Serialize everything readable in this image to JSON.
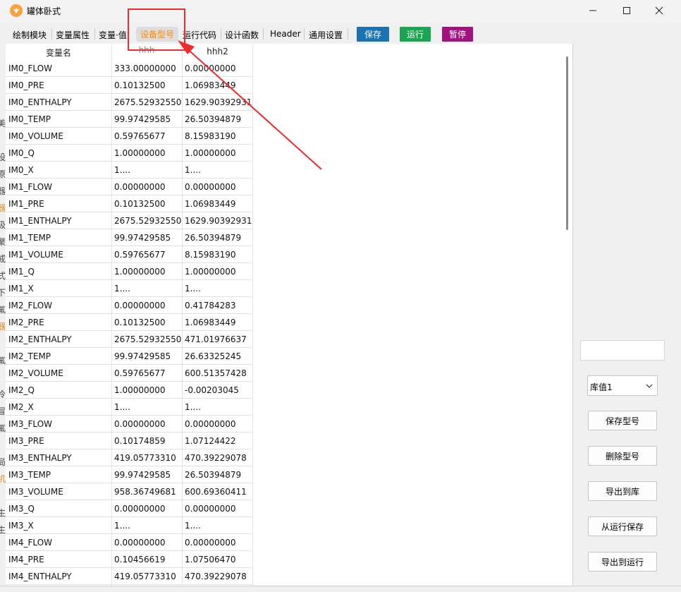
{
  "window": {
    "title": "罐体卧式",
    "controls": [
      "minimize",
      "maximize",
      "close"
    ]
  },
  "menu": {
    "tabs": [
      {
        "label": "绘制模块",
        "active": false
      },
      {
        "label": "变量属性",
        "active": false
      },
      {
        "label": "变量·值",
        "active": false
      },
      {
        "label": "设备型号",
        "active": true
      },
      {
        "label": "运行代码",
        "active": false
      },
      {
        "label": "设计函数",
        "active": false
      },
      {
        "label": "Header",
        "active": false
      },
      {
        "label": "通用设置",
        "active": false
      }
    ],
    "actions": [
      {
        "label": "保存",
        "color": "#1a72b0"
      },
      {
        "label": "运行",
        "color": "#1ba553"
      },
      {
        "label": "暂停",
        "color": "#a0137f"
      }
    ]
  },
  "table": {
    "columns": [
      "变量名",
      "hhh",
      "hhh2"
    ],
    "rows": [
      [
        "IM0_FLOW",
        "333.00000000",
        "0.00000000"
      ],
      [
        "IM0_PRE",
        "0.10132500",
        "1.06983449"
      ],
      [
        "IM0_ENTHALPY",
        "2675.52932550",
        "1629.90392931"
      ],
      [
        "IM0_TEMP",
        "99.97429585",
        "26.50394879"
      ],
      [
        "IM0_VOLUME",
        "0.59765677",
        "8.15983190"
      ],
      [
        "IM0_Q",
        "1.00000000",
        "1.00000000"
      ],
      [
        "IM0_X",
        "1....",
        "1...."
      ],
      [
        "IM1_FLOW",
        "0.00000000",
        "0.00000000"
      ],
      [
        "IM1_PRE",
        "0.10132500",
        "1.06983449"
      ],
      [
        "IM1_ENTHALPY",
        "2675.52932550",
        "1629.90392931"
      ],
      [
        "IM1_TEMP",
        "99.97429585",
        "26.50394879"
      ],
      [
        "IM1_VOLUME",
        "0.59765677",
        "8.15983190"
      ],
      [
        "IM1_Q",
        "1.00000000",
        "1.00000000"
      ],
      [
        "IM1_X",
        "1....",
        "1...."
      ],
      [
        "IM2_FLOW",
        "0.00000000",
        "0.41784283"
      ],
      [
        "IM2_PRE",
        "0.10132500",
        "1.06983449"
      ],
      [
        "IM2_ENTHALPY",
        "2675.52932550",
        "471.01976637"
      ],
      [
        "IM2_TEMP",
        "99.97429585",
        "26.63325245"
      ],
      [
        "IM2_VOLUME",
        "0.59765677",
        "600.51357428"
      ],
      [
        "IM2_Q",
        "1.00000000",
        "-0.00203045"
      ],
      [
        "IM2_X",
        "1....",
        "1...."
      ],
      [
        "IM3_FLOW",
        "0.00000000",
        "0.00000000"
      ],
      [
        "IM3_PRE",
        "0.10174859",
        "1.07124422"
      ],
      [
        "IM3_ENTHALPY",
        "419.05773310",
        "470.39229078"
      ],
      [
        "IM3_TEMP",
        "99.97429585",
        "26.50394879"
      ],
      [
        "IM3_VOLUME",
        "958.36749681",
        "600.69360411"
      ],
      [
        "IM3_Q",
        "0.00000000",
        "0.00000000"
      ],
      [
        "IM3_X",
        "1....",
        "1...."
      ],
      [
        "IM4_FLOW",
        "0.00000000",
        "0.00000000"
      ],
      [
        "IM4_PRE",
        "0.10456619",
        "1.07506470"
      ],
      [
        "IM4_ENTHALPY",
        "419.05773310",
        "470.39229078"
      ]
    ]
  },
  "left_strip_chars": [
    "美",
    "设",
    "原",
    "器",
    "器",
    "吸",
    "聚",
    "戒",
    "式",
    "下",
    "氟",
    "器",
    "氟",
    "冷",
    "冒",
    "氟",
    "局",
    "机",
    "生",
    "生"
  ],
  "right_panel": {
    "text_value": "",
    "select_value": "库值1",
    "buttons": [
      "保存型号",
      "删除型号",
      "导出到库",
      "从运行保存",
      "导出到运行"
    ]
  },
  "annotation": {
    "color": "#ef2b2b"
  }
}
